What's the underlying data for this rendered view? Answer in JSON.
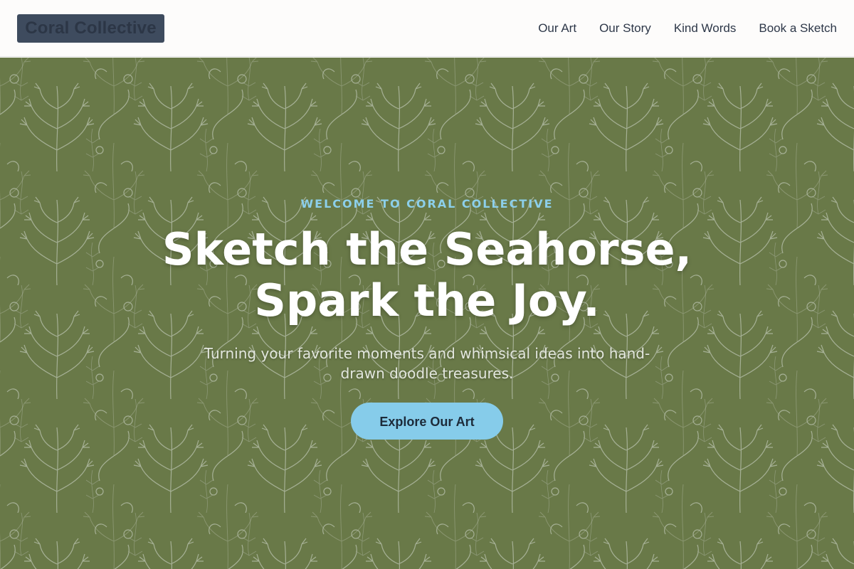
{
  "header": {
    "logo_text": "Coral Collective",
    "nav": [
      {
        "label": "Our Art"
      },
      {
        "label": "Our Story"
      },
      {
        "label": "Kind Words"
      },
      {
        "label": "Book a Sketch"
      }
    ]
  },
  "hero": {
    "eyebrow": "WELCOME TO CORAL COLLECTIVE",
    "headline_line1": "Sketch the Seahorse,",
    "headline_line2": "Spark the Joy.",
    "subtitle": "Turning your favorite moments and whimsical ideas into hand-drawn doodle treasures.",
    "cta_label": "Explore Our Art",
    "background": "green botanical fern pattern"
  },
  "colors": {
    "header_bg": "#fdfcfb",
    "logo_bg": "#3e4b5e",
    "nav_text": "#2d3748",
    "hero_green": "#6f7f4c",
    "accent_blue": "#86ccea",
    "eyebrow_blue": "#8ccfea"
  }
}
